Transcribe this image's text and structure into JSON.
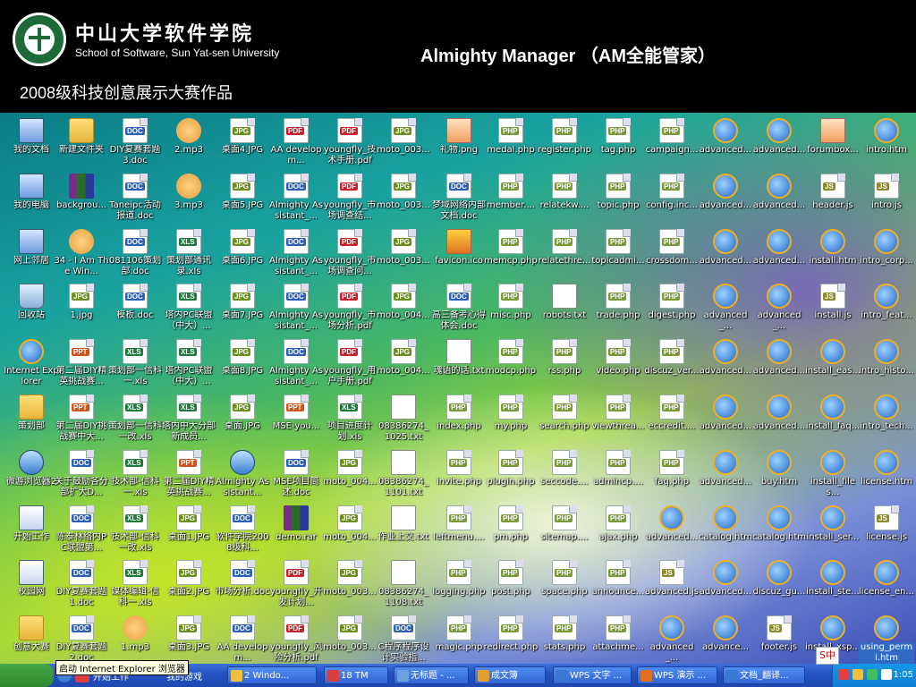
{
  "header": {
    "university_cn": "中山大学软件学院",
    "university_en": "School of Software, Sun Yat-sen University",
    "app_title": "Almighty Manager （AM全能管家）",
    "subtitle": "2008级科技创意展示大赛作品"
  },
  "desktop": {
    "columns": [
      [
        {
          "label": "我的文档",
          "icon": "sys"
        },
        {
          "label": "我的电脑",
          "icon": "sys"
        },
        {
          "label": "网上邻居",
          "icon": "sys"
        },
        {
          "label": "回收站",
          "icon": "bin"
        },
        {
          "label": "Internet Explorer",
          "icon": "ie"
        },
        {
          "label": "策划部",
          "icon": "folder"
        },
        {
          "label": "微游浏览器2",
          "icon": "exe"
        },
        {
          "label": "开始工作",
          "icon": "app"
        },
        {
          "label": "校园网",
          "icon": "app"
        },
        {
          "label": "创意大赛",
          "icon": "folder"
        }
      ],
      [
        {
          "label": "新建文件夹",
          "icon": "folder"
        },
        {
          "label": "backgrou...",
          "icon": "rar"
        },
        {
          "label": "34 - I Am The Win...",
          "icon": "mp3"
        },
        {
          "label": "1.jpg",
          "icon": "jpg"
        },
        {
          "label": "第二届DIY精英挑战赛...",
          "icon": "ppt"
        },
        {
          "label": "第二届DIY挑战赛中大...",
          "icon": "ppt"
        },
        {
          "label": "关于鼓励各分部扩大D...",
          "icon": "doc"
        },
        {
          "label": "陈泰林络内PC联盟第...",
          "icon": "doc"
        },
        {
          "label": "DIY复赛套题1.doc",
          "icon": "doc"
        },
        {
          "label": "DIY复赛套题2.doc",
          "icon": "doc"
        }
      ],
      [
        {
          "label": "DIY复赛套题3.doc",
          "icon": "doc"
        },
        {
          "label": "Taneipc活动报道.doc",
          "icon": "doc"
        },
        {
          "label": "081106策划部.doc",
          "icon": "doc"
        },
        {
          "label": "模板.doc",
          "icon": "doc"
        },
        {
          "label": "策划部一信科一.xls",
          "icon": "xls"
        },
        {
          "label": "策划部一信科一改.xls",
          "icon": "xls"
        },
        {
          "label": "技术部-信科一.xls",
          "icon": "xls"
        },
        {
          "label": "技术部-信科一改.xls",
          "icon": "xls"
        },
        {
          "label": "媒体编辑-信科一.xls",
          "icon": "xls"
        },
        {
          "label": "1.mp3",
          "icon": "mp3"
        }
      ],
      [
        {
          "label": "2.mp3",
          "icon": "mp3"
        },
        {
          "label": "3.mp3",
          "icon": "mp3"
        },
        {
          "label": "策划部通讯录.xls",
          "icon": "xls"
        },
        {
          "label": "塔内PC联盟（中大）...",
          "icon": "xls"
        },
        {
          "label": "塔内PC联盟（中大）...",
          "icon": "xls"
        },
        {
          "label": "塔内中大分部新成员...",
          "icon": "xls"
        },
        {
          "label": "第二届DIY精英挑战赛...",
          "icon": "ppt"
        },
        {
          "label": "桌面1.JPG",
          "icon": "jpg"
        },
        {
          "label": "桌面2.JPG",
          "icon": "jpg"
        },
        {
          "label": "桌面3.JPG",
          "icon": "jpg"
        }
      ],
      [
        {
          "label": "桌面4.JPG",
          "icon": "jpg"
        },
        {
          "label": "桌面5.JPG",
          "icon": "jpg"
        },
        {
          "label": "桌面6.JPG",
          "icon": "jpg"
        },
        {
          "label": "桌面7.JPG",
          "icon": "jpg"
        },
        {
          "label": "桌面8.JPG",
          "icon": "jpg"
        },
        {
          "label": "桌面.JPG",
          "icon": "jpg"
        },
        {
          "label": "Almighty Assistant...",
          "icon": "exe"
        },
        {
          "label": "软件学院2008级科...",
          "icon": "doc"
        },
        {
          "label": "市场分析.doc",
          "icon": "doc"
        },
        {
          "label": "AA developm...",
          "icon": "doc"
        }
      ],
      [
        {
          "label": "AA developm...",
          "icon": "pdf"
        },
        {
          "label": "Almighty Assistant_...",
          "icon": "doc"
        },
        {
          "label": "Almighty Assistant_...",
          "icon": "doc"
        },
        {
          "label": "Almighty Assistant_...",
          "icon": "doc"
        },
        {
          "label": "Almighty Assistant_...",
          "icon": "doc"
        },
        {
          "label": "MSE-you...",
          "icon": "ppt"
        },
        {
          "label": "MSE项目简述.doc",
          "icon": "doc"
        },
        {
          "label": "demo.rar",
          "icon": "rar"
        },
        {
          "label": "youngfly_开发计划...",
          "icon": "pdf"
        },
        {
          "label": "youngfly_风险分析.pdf",
          "icon": "pdf"
        }
      ],
      [
        {
          "label": "youngfly_技术手册.pdf",
          "icon": "pdf"
        },
        {
          "label": "youngfly_市场调查结...",
          "icon": "pdf"
        },
        {
          "label": "youngfly_市场调查问...",
          "icon": "pdf"
        },
        {
          "label": "youngfly_市场分析.pdf",
          "icon": "pdf"
        },
        {
          "label": "youngfly_用户手册.pdf",
          "icon": "pdf"
        },
        {
          "label": "项目进度计划.xls",
          "icon": "xls"
        },
        {
          "label": "moto_004...",
          "icon": "jpg"
        },
        {
          "label": "moto_004...",
          "icon": "jpg"
        },
        {
          "label": "moto_003...",
          "icon": "jpg"
        },
        {
          "label": "moto_003...",
          "icon": "jpg"
        }
      ],
      [
        {
          "label": "moto_003...",
          "icon": "jpg"
        },
        {
          "label": "moto_003...",
          "icon": "jpg"
        },
        {
          "label": "moto_003...",
          "icon": "jpg"
        },
        {
          "label": "moto_004...",
          "icon": "jpg"
        },
        {
          "label": "moto_004...",
          "icon": "jpg"
        },
        {
          "label": "08386274_1025.txt",
          "icon": "txt"
        },
        {
          "label": "08386274_1101.txt",
          "icon": "txt"
        },
        {
          "label": "作业上交.txt",
          "icon": "txt"
        },
        {
          "label": "08386274_1108.txt",
          "icon": "txt"
        },
        {
          "label": "C程序程序设计实验指...",
          "icon": "doc"
        }
      ],
      [
        {
          "label": "礼物.png",
          "icon": "png"
        },
        {
          "label": "梦域网络内部文档.doc",
          "icon": "doc"
        },
        {
          "label": "favicon.ico",
          "icon": "ico"
        },
        {
          "label": "高三备考心得体会.doc",
          "icon": "doc"
        },
        {
          "label": "魂语的话.txt",
          "icon": "txt"
        },
        {
          "label": "index.php",
          "icon": "php"
        },
        {
          "label": "invite.php",
          "icon": "php"
        },
        {
          "label": "leftmenu....",
          "icon": "php"
        },
        {
          "label": "logging.php",
          "icon": "php"
        },
        {
          "label": "magic.php",
          "icon": "php"
        }
      ],
      [
        {
          "label": "medal.php",
          "icon": "php"
        },
        {
          "label": "member....",
          "icon": "php"
        },
        {
          "label": "memcp.php",
          "icon": "php"
        },
        {
          "label": "misc.php",
          "icon": "php"
        },
        {
          "label": "modcp.php",
          "icon": "php"
        },
        {
          "label": "my.php",
          "icon": "php"
        },
        {
          "label": "plugin.php",
          "icon": "php"
        },
        {
          "label": "pm.php",
          "icon": "php"
        },
        {
          "label": "post.php",
          "icon": "php"
        },
        {
          "label": "redirect.php",
          "icon": "php"
        }
      ],
      [
        {
          "label": "register.php",
          "icon": "php"
        },
        {
          "label": "relatekw....",
          "icon": "php"
        },
        {
          "label": "relatethre...",
          "icon": "php"
        },
        {
          "label": "robots.txt",
          "icon": "txt"
        },
        {
          "label": "rss.php",
          "icon": "php"
        },
        {
          "label": "search.php",
          "icon": "php"
        },
        {
          "label": "seccode....",
          "icon": "php"
        },
        {
          "label": "sitemap....",
          "icon": "php"
        },
        {
          "label": "space.php",
          "icon": "php"
        },
        {
          "label": "stats.php",
          "icon": "php"
        }
      ],
      [
        {
          "label": "tag.php",
          "icon": "php"
        },
        {
          "label": "topic.php",
          "icon": "php"
        },
        {
          "label": "topicadmi...",
          "icon": "php"
        },
        {
          "label": "trade.php",
          "icon": "php"
        },
        {
          "label": "video.php",
          "icon": "php"
        },
        {
          "label": "viewthrea...",
          "icon": "php"
        },
        {
          "label": "admincp....",
          "icon": "php"
        },
        {
          "label": "ajax.php",
          "icon": "php"
        },
        {
          "label": "announce...",
          "icon": "php"
        },
        {
          "label": "attachme...",
          "icon": "php"
        }
      ],
      [
        {
          "label": "campaign...",
          "icon": "php"
        },
        {
          "label": "config.inc...",
          "icon": "php"
        },
        {
          "label": "crossdom...",
          "icon": "php"
        },
        {
          "label": "digest.php",
          "icon": "php"
        },
        {
          "label": "discuz_ver...",
          "icon": "php"
        },
        {
          "label": "eccredit....",
          "icon": "php"
        },
        {
          "label": "faq.php",
          "icon": "php"
        },
        {
          "label": "advanced...",
          "icon": "htm"
        },
        {
          "label": "advanced.js",
          "icon": "js"
        },
        {
          "label": "advanced_...",
          "icon": "htm"
        }
      ],
      [
        {
          "label": "advanced...",
          "icon": "htm"
        },
        {
          "label": "advanced...",
          "icon": "htm"
        },
        {
          "label": "advanced...",
          "icon": "htm"
        },
        {
          "label": "advanced_...",
          "icon": "htm"
        },
        {
          "label": "advanced...",
          "icon": "htm"
        },
        {
          "label": "advanced...",
          "icon": "htm"
        },
        {
          "label": "advanced...",
          "icon": "htm"
        },
        {
          "label": "catalog.htm",
          "icon": "htm"
        },
        {
          "label": "advanced...",
          "icon": "htm"
        },
        {
          "label": "advance...",
          "icon": "htm"
        }
      ],
      [
        {
          "label": "advanced...",
          "icon": "htm"
        },
        {
          "label": "advanced...",
          "icon": "htm"
        },
        {
          "label": "advanced...",
          "icon": "htm"
        },
        {
          "label": "advanced_...",
          "icon": "htm"
        },
        {
          "label": "advanced...",
          "icon": "htm"
        },
        {
          "label": "advanced...",
          "icon": "htm"
        },
        {
          "label": "buy.htm",
          "icon": "htm"
        },
        {
          "label": "catalog.htm",
          "icon": "htm"
        },
        {
          "label": "discuz_gu...",
          "icon": "htm"
        },
        {
          "label": "footer.js",
          "icon": "js"
        }
      ],
      [
        {
          "label": "forumbox...",
          "icon": "png"
        },
        {
          "label": "header.js",
          "icon": "js"
        },
        {
          "label": "install.htm",
          "icon": "htm"
        },
        {
          "label": "install.js",
          "icon": "js"
        },
        {
          "label": "install_eas...",
          "icon": "htm"
        },
        {
          "label": "install_faq...",
          "icon": "htm"
        },
        {
          "label": "install_files...",
          "icon": "htm"
        },
        {
          "label": "install_ser...",
          "icon": "htm"
        },
        {
          "label": "install_ste...",
          "icon": "htm"
        },
        {
          "label": "install_xsp...",
          "icon": "htm"
        }
      ],
      [
        {
          "label": "intro.htm",
          "icon": "htm"
        },
        {
          "label": "intro.js",
          "icon": "js"
        },
        {
          "label": "intro_corp...",
          "icon": "htm"
        },
        {
          "label": "intro_feat...",
          "icon": "htm"
        },
        {
          "label": "intro_histo...",
          "icon": "htm"
        },
        {
          "label": "intro_tech...",
          "icon": "htm"
        },
        {
          "label": "license.htm",
          "icon": "htm"
        },
        {
          "label": "license.js",
          "icon": "js"
        },
        {
          "label": "license_en...",
          "icon": "htm"
        },
        {
          "label": "using_permi.htm",
          "icon": "htm",
          "selected": true
        }
      ]
    ]
  },
  "tooltip": "启动 Internet Explorer 浏览器",
  "taskbar": {
    "start_label": "开始工作",
    "quick_launch_text": "我的游戏",
    "buttons": [
      {
        "label": "2 Windo...",
        "color": "#f0c040"
      },
      {
        "label": "18 TM",
        "color": "#d84040"
      },
      {
        "label": "无标题 - ...",
        "color": "#6aa0e0"
      },
      {
        "label": "成文簿",
        "color": "#e0a030"
      },
      {
        "label": "WPS 文字 ...",
        "color": "#3a78d8"
      },
      {
        "label": "WPS 演示 ...",
        "color": "#e07020"
      },
      {
        "label": "文档_翻译...",
        "color": "#3a78d8"
      }
    ],
    "clock": "1:05",
    "ime_label": "S中"
  },
  "colors": {
    "header_bg": "#000000",
    "taskbar": "#2454c4",
    "tray": "#0f7fd6",
    "selection": "#316ac5"
  }
}
